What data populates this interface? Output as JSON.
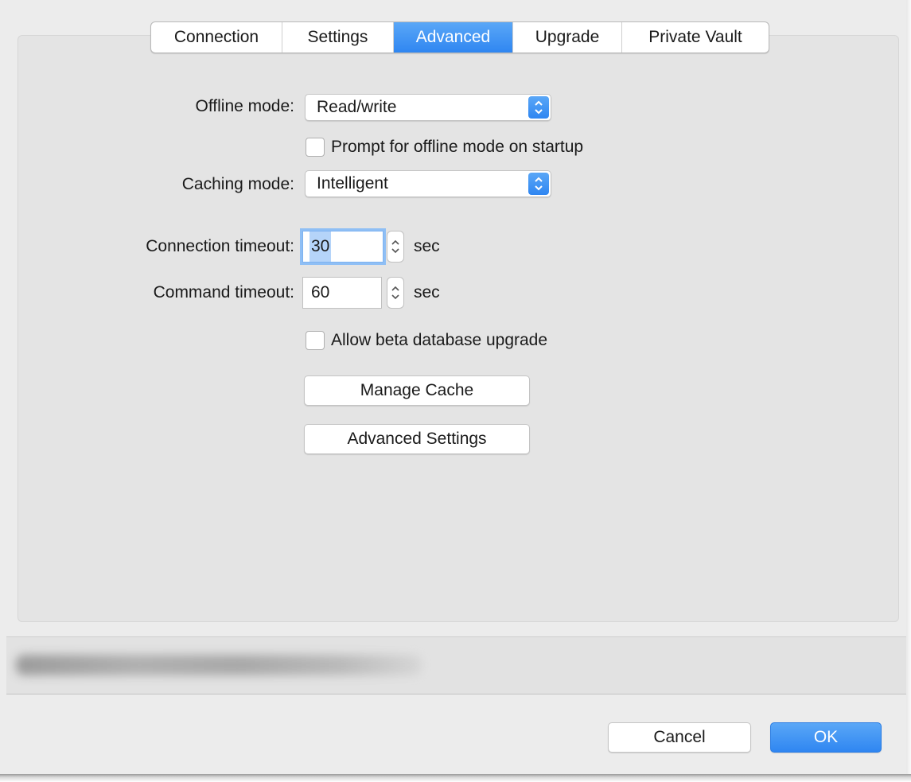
{
  "tabs": [
    {
      "label": "Connection",
      "active": false
    },
    {
      "label": "Settings",
      "active": false
    },
    {
      "label": "Advanced",
      "active": true
    },
    {
      "label": "Upgrade",
      "active": false
    },
    {
      "label": "Private Vault",
      "active": false
    }
  ],
  "offline_mode": {
    "label": "Offline mode:",
    "value": "Read/write"
  },
  "prompt_offline": {
    "label": "Prompt for offline mode on startup",
    "checked": false
  },
  "caching_mode": {
    "label": "Caching mode:",
    "value": "Intelligent"
  },
  "connection_timeout": {
    "label": "Connection timeout:",
    "value": "30",
    "unit": "sec"
  },
  "command_timeout": {
    "label": "Command timeout:",
    "value": "60",
    "unit": "sec"
  },
  "allow_beta": {
    "label": "Allow beta database upgrade",
    "checked": false
  },
  "buttons": {
    "manage_cache": "Manage Cache",
    "advanced_settings": "Advanced Settings",
    "cancel": "Cancel",
    "ok": "OK"
  },
  "colors": {
    "accent": "#2f86f1",
    "window_bg": "#ececec",
    "panel_bg": "#e4e4e4"
  },
  "icons": {
    "popup_arrows": "up-down-chevrons-icon",
    "stepper": "stepper-arrows-icon"
  }
}
